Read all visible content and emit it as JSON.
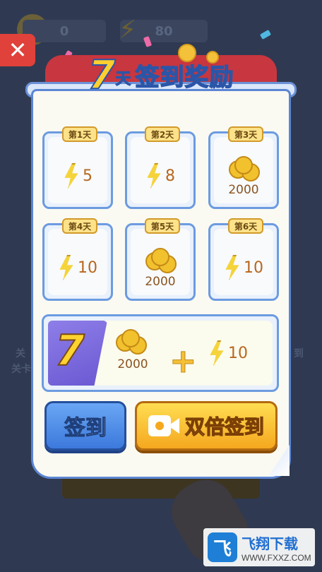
{
  "hud": {
    "coins": "0",
    "energy": "80"
  },
  "close_label": "✕",
  "title": {
    "number": "7",
    "unit": "天",
    "text": "签到奖励"
  },
  "days": [
    {
      "label": "第1天",
      "type": "energy",
      "amount": "5"
    },
    {
      "label": "第2天",
      "type": "energy",
      "amount": "8"
    },
    {
      "label": "第3天",
      "type": "coins",
      "amount": "2000"
    },
    {
      "label": "第4天",
      "type": "energy",
      "amount": "10"
    },
    {
      "label": "第5天",
      "type": "coins",
      "amount": "2000"
    },
    {
      "label": "第6天",
      "type": "energy",
      "amount": "10"
    }
  ],
  "day7": {
    "number": "7",
    "coins": "2000",
    "plus": "+",
    "energy": "10"
  },
  "buttons": {
    "sign": "签到",
    "double_sign": "双倍签到"
  },
  "background": {
    "left_text_1": "关",
    "left_text_2": "关卡",
    "right_text": "到"
  },
  "watermark": {
    "logo": "飞",
    "name": "飞翔下载",
    "url": "WWW.FXXZ.COM"
  },
  "colors": {
    "accent_blue": "#3c79dc",
    "accent_gold": "#f5a81f",
    "energy": "#f5d33a",
    "ribbon": "#c8363f"
  }
}
